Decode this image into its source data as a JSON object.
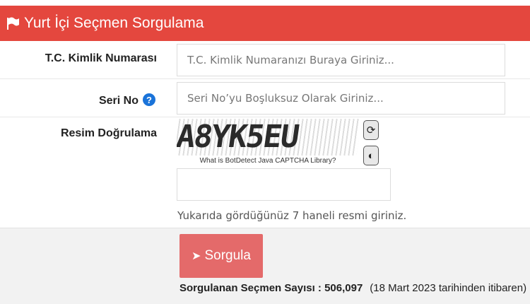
{
  "header": {
    "title": "Yurt İçi Seçmen Sorgulama",
    "icon": "flag-icon"
  },
  "tc": {
    "label": "T.C. Kimlik Numarası",
    "placeholder": "T.C. Kimlik Numaranızı Buraya Giriniz..."
  },
  "seri": {
    "label": "Seri No",
    "help": "?",
    "placeholder": "Seri No’yu Boşluksuz Olarak Giriniz..."
  },
  "captcha": {
    "label": "Resim Doğrulama",
    "image_text": "A8YK5EU",
    "caption": "What is BotDetect Java CAPTCHA Library?",
    "hint": "Yukarıda gördüğünüz 7 haneli resmi giriniz.",
    "refresh_icon": "refresh-icon",
    "sound_icon": "speaker-icon"
  },
  "submit": {
    "label": "Sorgula"
  },
  "stats": {
    "label": "Sorgulanan Seçmen Sayısı : 506,097",
    "since": "(18 Mart 2023 tarihinden itibaren)"
  },
  "colors": {
    "header": "#e4473e",
    "button": "#e46a6a",
    "help": "#1a73d9"
  }
}
